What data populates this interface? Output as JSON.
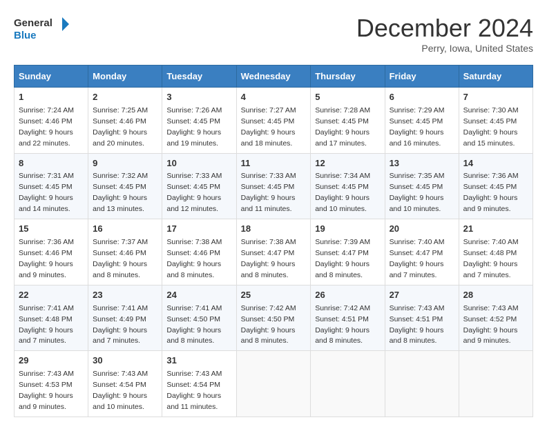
{
  "logo": {
    "line1": "General",
    "line2": "Blue"
  },
  "title": "December 2024",
  "subtitle": "Perry, Iowa, United States",
  "weekdays": [
    "Sunday",
    "Monday",
    "Tuesday",
    "Wednesday",
    "Thursday",
    "Friday",
    "Saturday"
  ],
  "weeks": [
    [
      {
        "day": "1",
        "sunrise": "7:24 AM",
        "sunset": "4:46 PM",
        "daylight": "9 hours and 22 minutes."
      },
      {
        "day": "2",
        "sunrise": "7:25 AM",
        "sunset": "4:46 PM",
        "daylight": "9 hours and 20 minutes."
      },
      {
        "day": "3",
        "sunrise": "7:26 AM",
        "sunset": "4:45 PM",
        "daylight": "9 hours and 19 minutes."
      },
      {
        "day": "4",
        "sunrise": "7:27 AM",
        "sunset": "4:45 PM",
        "daylight": "9 hours and 18 minutes."
      },
      {
        "day": "5",
        "sunrise": "7:28 AM",
        "sunset": "4:45 PM",
        "daylight": "9 hours and 17 minutes."
      },
      {
        "day": "6",
        "sunrise": "7:29 AM",
        "sunset": "4:45 PM",
        "daylight": "9 hours and 16 minutes."
      },
      {
        "day": "7",
        "sunrise": "7:30 AM",
        "sunset": "4:45 PM",
        "daylight": "9 hours and 15 minutes."
      }
    ],
    [
      {
        "day": "8",
        "sunrise": "7:31 AM",
        "sunset": "4:45 PM",
        "daylight": "9 hours and 14 minutes."
      },
      {
        "day": "9",
        "sunrise": "7:32 AM",
        "sunset": "4:45 PM",
        "daylight": "9 hours and 13 minutes."
      },
      {
        "day": "10",
        "sunrise": "7:33 AM",
        "sunset": "4:45 PM",
        "daylight": "9 hours and 12 minutes."
      },
      {
        "day": "11",
        "sunrise": "7:33 AM",
        "sunset": "4:45 PM",
        "daylight": "9 hours and 11 minutes."
      },
      {
        "day": "12",
        "sunrise": "7:34 AM",
        "sunset": "4:45 PM",
        "daylight": "9 hours and 10 minutes."
      },
      {
        "day": "13",
        "sunrise": "7:35 AM",
        "sunset": "4:45 PM",
        "daylight": "9 hours and 10 minutes."
      },
      {
        "day": "14",
        "sunrise": "7:36 AM",
        "sunset": "4:45 PM",
        "daylight": "9 hours and 9 minutes."
      }
    ],
    [
      {
        "day": "15",
        "sunrise": "7:36 AM",
        "sunset": "4:46 PM",
        "daylight": "9 hours and 9 minutes."
      },
      {
        "day": "16",
        "sunrise": "7:37 AM",
        "sunset": "4:46 PM",
        "daylight": "9 hours and 8 minutes."
      },
      {
        "day": "17",
        "sunrise": "7:38 AM",
        "sunset": "4:46 PM",
        "daylight": "9 hours and 8 minutes."
      },
      {
        "day": "18",
        "sunrise": "7:38 AM",
        "sunset": "4:47 PM",
        "daylight": "9 hours and 8 minutes."
      },
      {
        "day": "19",
        "sunrise": "7:39 AM",
        "sunset": "4:47 PM",
        "daylight": "9 hours and 8 minutes."
      },
      {
        "day": "20",
        "sunrise": "7:40 AM",
        "sunset": "4:47 PM",
        "daylight": "9 hours and 7 minutes."
      },
      {
        "day": "21",
        "sunrise": "7:40 AM",
        "sunset": "4:48 PM",
        "daylight": "9 hours and 7 minutes."
      }
    ],
    [
      {
        "day": "22",
        "sunrise": "7:41 AM",
        "sunset": "4:48 PM",
        "daylight": "9 hours and 7 minutes."
      },
      {
        "day": "23",
        "sunrise": "7:41 AM",
        "sunset": "4:49 PM",
        "daylight": "9 hours and 7 minutes."
      },
      {
        "day": "24",
        "sunrise": "7:41 AM",
        "sunset": "4:50 PM",
        "daylight": "9 hours and 8 minutes."
      },
      {
        "day": "25",
        "sunrise": "7:42 AM",
        "sunset": "4:50 PM",
        "daylight": "9 hours and 8 minutes."
      },
      {
        "day": "26",
        "sunrise": "7:42 AM",
        "sunset": "4:51 PM",
        "daylight": "9 hours and 8 minutes."
      },
      {
        "day": "27",
        "sunrise": "7:43 AM",
        "sunset": "4:51 PM",
        "daylight": "9 hours and 8 minutes."
      },
      {
        "day": "28",
        "sunrise": "7:43 AM",
        "sunset": "4:52 PM",
        "daylight": "9 hours and 9 minutes."
      }
    ],
    [
      {
        "day": "29",
        "sunrise": "7:43 AM",
        "sunset": "4:53 PM",
        "daylight": "9 hours and 9 minutes."
      },
      {
        "day": "30",
        "sunrise": "7:43 AM",
        "sunset": "4:54 PM",
        "daylight": "9 hours and 10 minutes."
      },
      {
        "day": "31",
        "sunrise": "7:43 AM",
        "sunset": "4:54 PM",
        "daylight": "9 hours and 11 minutes."
      },
      null,
      null,
      null,
      null
    ]
  ]
}
